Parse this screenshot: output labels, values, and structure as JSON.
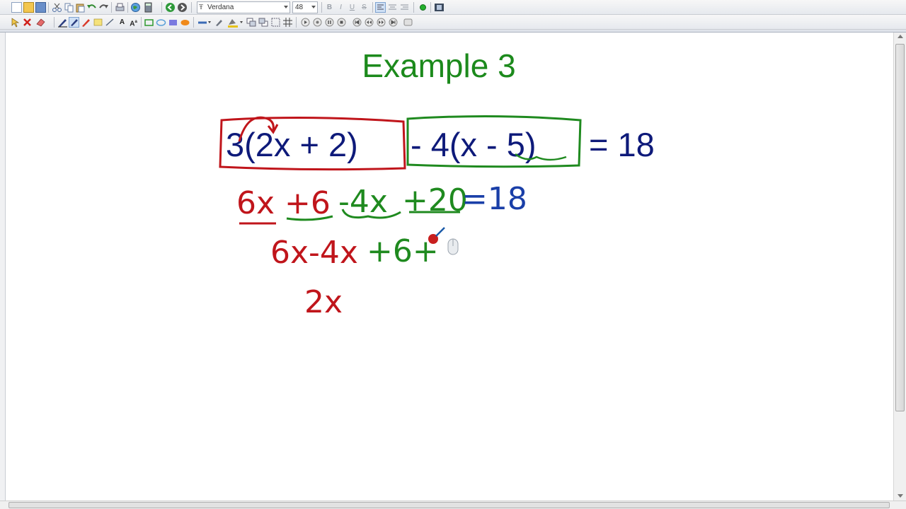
{
  "toolbar": {
    "font_name": "Verdana",
    "font_size": "48"
  },
  "page": {
    "title": "Example 3",
    "equation": {
      "group1": "3(2x + 2)",
      "group2": "- 4(x - 5)",
      "rhs": "= 18"
    },
    "handwriting": {
      "line1": [
        "6x",
        "+6",
        "-4x",
        "+20",
        "=18"
      ],
      "line2": [
        "6x-4x",
        "+6+"
      ],
      "line3": "2x"
    }
  },
  "colors": {
    "title": "#1c8a1c",
    "equation": "#0e1a7a",
    "red_ink": "#c0151b",
    "green_ink": "#1f8a1f",
    "blue_ink": "#1a3fa8"
  },
  "icons": [
    "new-icon",
    "open-icon",
    "save-icon",
    "cut-icon",
    "copy-icon",
    "paste-icon",
    "undo-icon",
    "redo-icon",
    "print-icon",
    "globe-icon",
    "calculator-icon",
    "back-icon",
    "forward-icon",
    "bold-icon",
    "italic-icon",
    "underline-icon",
    "strikethrough-icon",
    "align-left-icon",
    "align-center-icon",
    "align-right-icon",
    "record-icon",
    "film-icon",
    "select-icon",
    "delete-icon",
    "eraser-icon",
    "pen-icon",
    "highlighter-icon",
    "text-icon",
    "rectangle-icon",
    "ellipse-icon",
    "play-icon",
    "pause-icon",
    "stop-icon"
  ]
}
